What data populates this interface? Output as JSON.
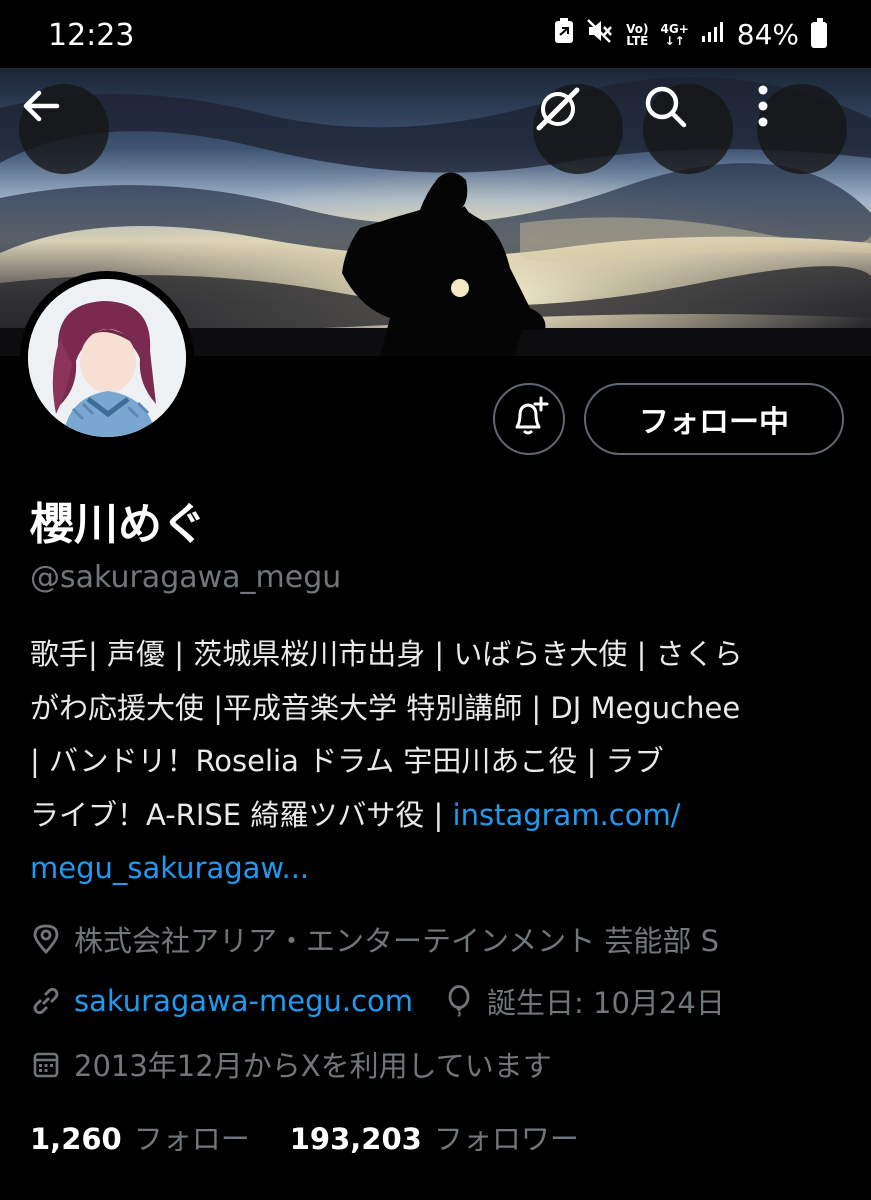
{
  "status_bar": {
    "time": "12:23",
    "network_top": "Vo)",
    "network_bottom": "LTE",
    "signal_type": "4G+",
    "battery": "84%"
  },
  "header": {
    "back_icon": "arrow-left-icon",
    "grok_icon": "grok-icon",
    "search_icon": "search-icon",
    "more_icon": "more-vertical-icon"
  },
  "profile": {
    "display_name": "櫻川めぐ",
    "handle": "@sakuragawa_megu",
    "follow_button": "フォロー中",
    "bio_lines": [
      "歌手| 声優 | 茨城県桜川市出身 | いばらき大使 | さくら",
      "がわ応援大使 |平成音楽大学 特別講師 | DJ Meguchee",
      "| バンドリ！Roselia ドラム 宇田川あこ役 | ラブ",
      "ライブ！A-RISE 綺羅ツバサ役 | "
    ],
    "bio_link_1": "instagram.com/",
    "bio_link_2": "megu_sakuragaw...",
    "location": "株式会社アリア・エンターテインメント 芸能部 S",
    "website": "sakuragawa-megu.com",
    "birthday": "誕生日: 10月24日",
    "joined": "2013年12月からXを利用しています",
    "following_count": "1,260",
    "following_label": "フォロー",
    "followers_count": "193,203",
    "followers_label": "フォロワー"
  },
  "colors": {
    "background": "#000000",
    "text_primary": "#e7e9ea",
    "text_secondary": "#71767b",
    "link": "#1d9bf0",
    "button_border": "#5f6770"
  }
}
